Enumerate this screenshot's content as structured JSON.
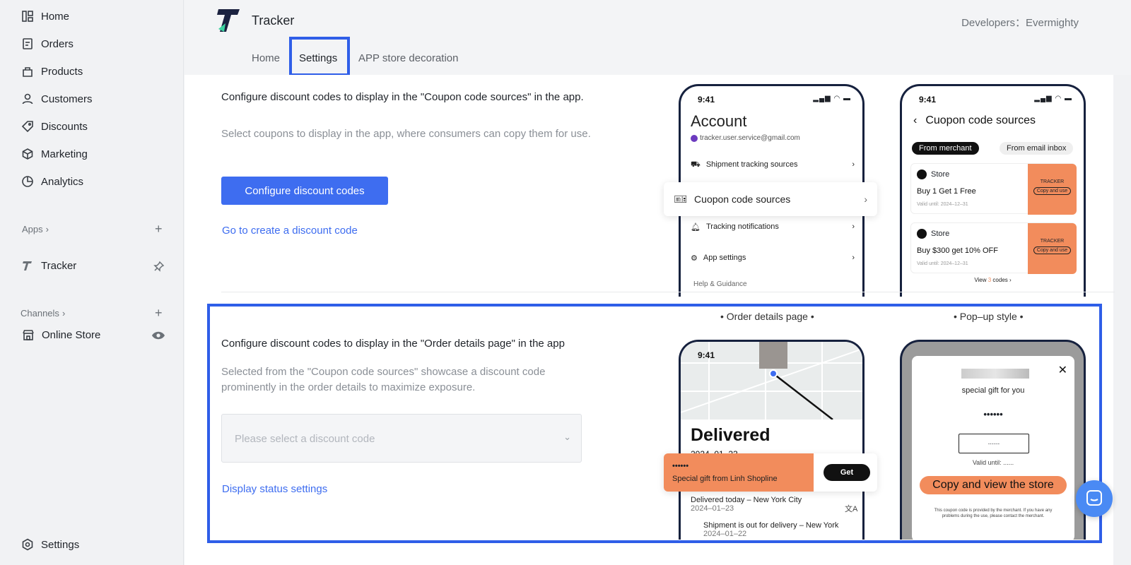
{
  "sidebar": {
    "items": [
      {
        "label": "Home",
        "icon": "home-icon"
      },
      {
        "label": "Orders",
        "icon": "orders-icon"
      },
      {
        "label": "Products",
        "icon": "products-icon"
      },
      {
        "label": "Customers",
        "icon": "customers-icon"
      },
      {
        "label": "Discounts",
        "icon": "discounts-icon"
      },
      {
        "label": "Marketing",
        "icon": "marketing-icon"
      },
      {
        "label": "Analytics",
        "icon": "analytics-icon"
      }
    ],
    "apps_label": "Apps",
    "app_tracker": "Tracker",
    "channels_label": "Channels",
    "online_store": "Online Store",
    "settings": "Settings"
  },
  "header": {
    "app_title": "Tracker",
    "developer": "Developers：Evermighty",
    "tabs": [
      "Home",
      "Settings",
      "APP store decoration"
    ],
    "active_tab": "Settings"
  },
  "section1": {
    "title": "Configure discount codes to display in the \"Coupon code sources\" in the app.",
    "desc": "Select coupons to display in the app, where consumers can copy them for use.",
    "button": "Configure discount codes",
    "link": "Go to create a discount code"
  },
  "section2": {
    "title": "Configure discount codes to display in the \"Order details page\" in the app",
    "desc": "Selected from the \"Coupon code sources\" showcase a discount code prominently in the order details to maximize exposure.",
    "select_placeholder": "Please select a discount code",
    "link": "Display status settings",
    "caption_order": "• Order details page •",
    "caption_popup": "• Pop–up style •"
  },
  "phone_account": {
    "time": "9:41",
    "title": "Account",
    "email": "tracker.user.service@gmail.com",
    "rows": [
      "Shipment tracking sources",
      "Cuopon code sources",
      "Tracking notifications",
      "App settings"
    ],
    "footer": "Help & Guidance"
  },
  "phone_coupon": {
    "time": "9:41",
    "title": "Cuopon code sources",
    "tab_a": "From merchant",
    "tab_b": "From email inbox",
    "store": "Store",
    "offer1": "Buy 1 Get 1 Free",
    "offer2": "Buy $300 get 10% OFF",
    "valid": "Valid until: 2024–12–31",
    "badge": "TRACKER",
    "copy": "Copy and use",
    "view_pre": "View ",
    "view_count": "3",
    "view_post": " codes"
  },
  "phone_order": {
    "time": "9:41",
    "status": "Delivered",
    "date": "2024–01–23",
    "gift_code": "••••••",
    "gift_text": "Special gift from Linh Shopline",
    "get": "Get",
    "event1": "Delivered today – New York City",
    "event1_date": "2024–01–23",
    "event2": "Shipment is out for delivery – New York",
    "event2_date": "2024–01–22"
  },
  "phone_popup": {
    "gift": "special gift for you",
    "code": "••••••",
    "input": "......",
    "valid": "Valid until: ......",
    "cta": "Copy and view the store",
    "note": "This coupon code is provided by the merchant. If you have any problems during the use, please contact the merchant."
  },
  "colors": {
    "accent": "#3e6df0",
    "orange": "#f28c5c",
    "phone_frame": "#16213e"
  }
}
